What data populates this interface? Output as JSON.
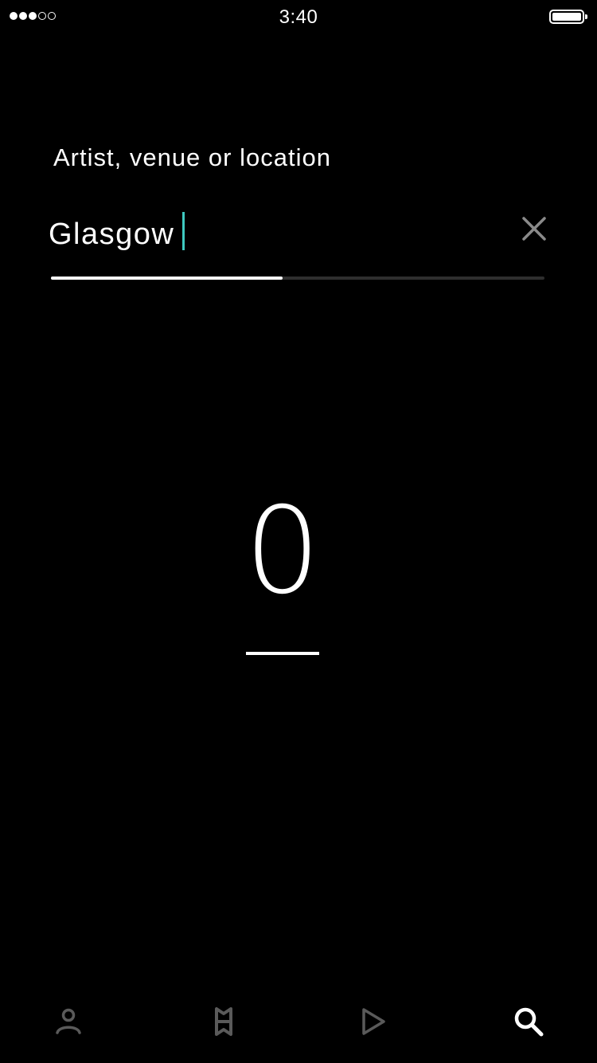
{
  "status_bar": {
    "time": "3:40",
    "signal_bars_filled": 3,
    "signal_bars_total": 5
  },
  "search": {
    "label": "Artist, venue or location",
    "value": "Glasgow",
    "progress": 0.47,
    "clear_icon": "close-icon",
    "caret_color": "#3fc9c0"
  },
  "results": {
    "count": "0"
  },
  "tab_bar": {
    "tabs": [
      {
        "icon": "profile-icon",
        "active": false
      },
      {
        "icon": "bookmark-icon",
        "active": false
      },
      {
        "icon": "play-icon",
        "active": false
      },
      {
        "icon": "search-icon",
        "active": true
      }
    ],
    "active_color": "#ffffff",
    "inactive_color": "#5a5a5a"
  }
}
